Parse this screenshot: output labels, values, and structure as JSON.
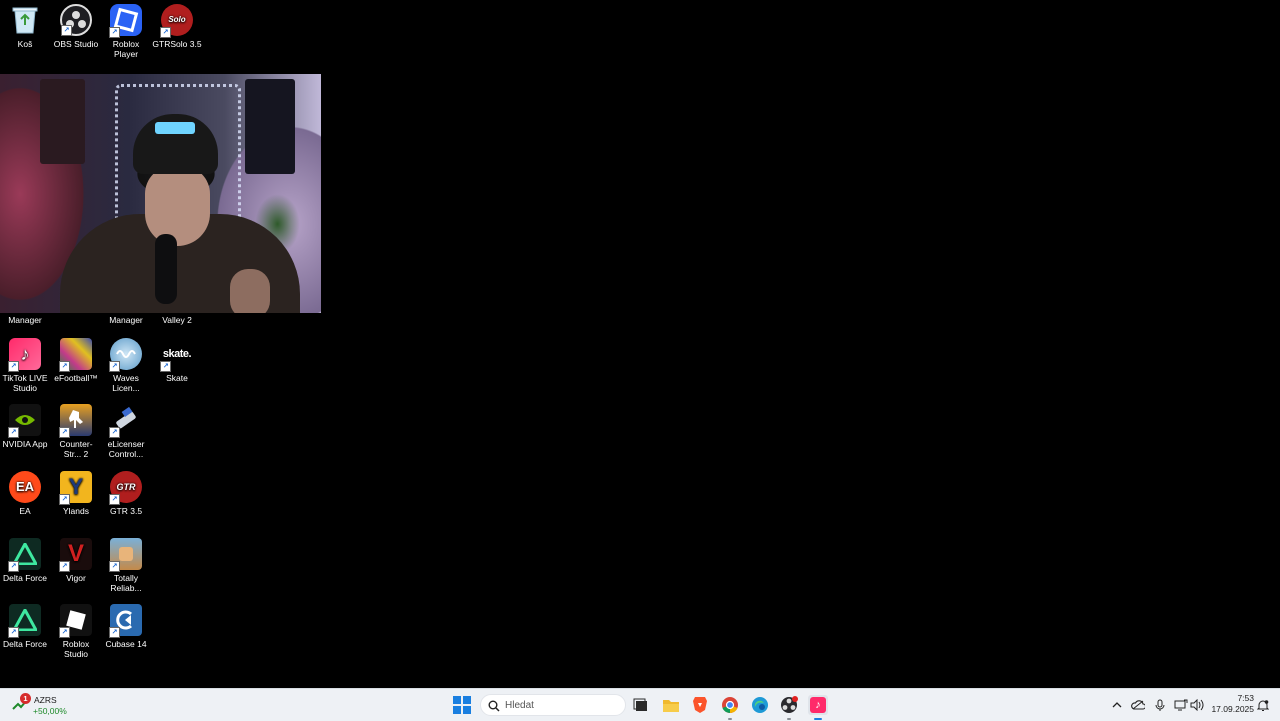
{
  "desktop": {
    "row1": [
      {
        "label": "Koš",
        "icon": "recycle-bin-icon"
      },
      {
        "label": "OBS Studio",
        "icon": "obs-studio-icon"
      },
      {
        "label": "Roblox Player",
        "icon": "roblox-player-icon"
      },
      {
        "label": "GTRSolo 3.5",
        "icon": "gtrsolo-icon"
      }
    ],
    "partial_labels": [
      "Manager",
      "Manager",
      "Valley 2"
    ],
    "row_tiktok": [
      {
        "label": "TikTok LIVE Studio",
        "icon": "tiktok-live-studio-icon"
      },
      {
        "label": "eFootball™",
        "icon": "efootball-icon"
      },
      {
        "label": "Waves Licen...",
        "icon": "waves-license-icon"
      },
      {
        "label": "Skate",
        "icon": "skate-icon",
        "logo_text": "skate."
      }
    ],
    "row_nvidia": [
      {
        "label": "NVIDIA App",
        "icon": "nvidia-app-icon"
      },
      {
        "label": "Counter-Str... 2",
        "icon": "counter-strike-icon"
      },
      {
        "label": "eLicenser Control...",
        "icon": "elicenser-icon"
      }
    ],
    "row_ea": [
      {
        "label": "EA",
        "icon": "ea-icon",
        "logo_text": "EA"
      },
      {
        "label": "Ylands",
        "icon": "ylands-icon",
        "logo_text": "Y"
      },
      {
        "label": "GTR 3.5",
        "icon": "gtr-icon",
        "logo_text": "GTR"
      }
    ],
    "row_delta": [
      {
        "label": "Delta Force",
        "icon": "delta-force-icon"
      },
      {
        "label": "Vigor",
        "icon": "vigor-icon",
        "logo_text": "V"
      },
      {
        "label": "Totally Reliab...",
        "icon": "totally-reliable-icon"
      }
    ],
    "row_last": [
      {
        "label": "Delta Force",
        "icon": "delta-force-icon"
      },
      {
        "label": "Roblox Studio",
        "icon": "roblox-studio-icon"
      },
      {
        "label": "Cubase 14",
        "icon": "cubase-icon"
      }
    ]
  },
  "webcam": {
    "label": "webcam overlay"
  },
  "taskbar": {
    "widget": {
      "badge": "1",
      "symbol": "AZRS",
      "change": "+50,00%"
    },
    "search_placeholder": "Hledat",
    "apps": [
      "task-view-icon",
      "file-explorer-icon",
      "brave-icon",
      "chrome-icon",
      "edge-icon",
      "obs-icon",
      "tiktok-icon"
    ],
    "tray": [
      "chevron-up-icon",
      "onedrive-icon",
      "microphone-icon",
      "network-icon",
      "volume-icon"
    ],
    "time": "7:53",
    "date": "17.09.2025"
  },
  "colors": {
    "accent": "#1a7fe0",
    "taskbar_bg": "#eef1f5",
    "desktop_bg": "#000000"
  }
}
